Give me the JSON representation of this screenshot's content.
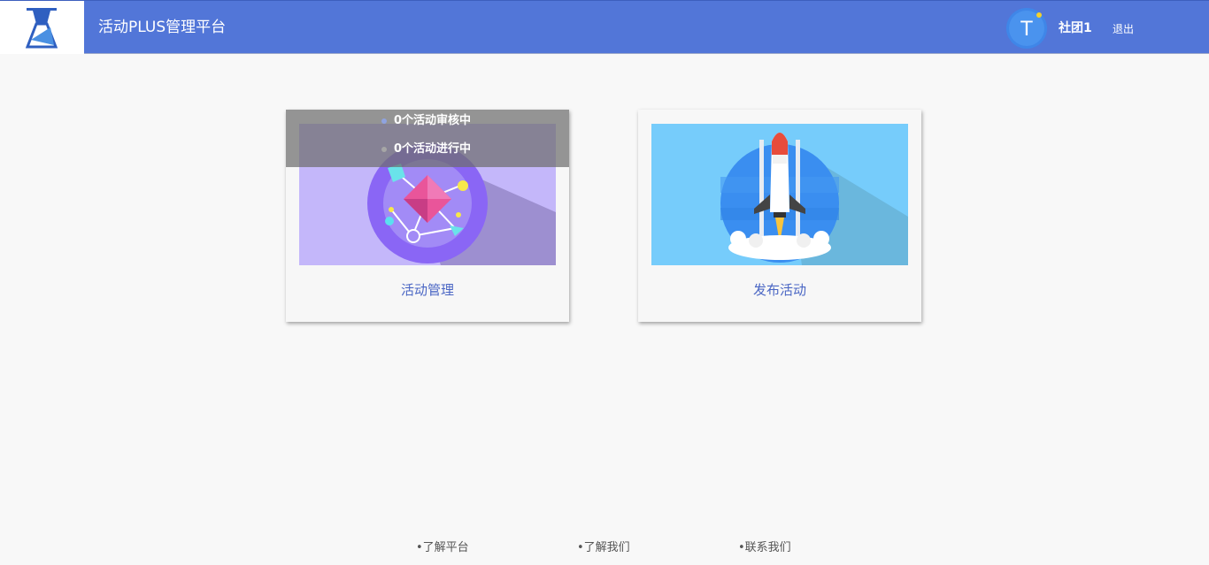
{
  "header": {
    "title": "活动PLUS管理平台",
    "user_name": "社团1",
    "logout_label": "退出",
    "avatar_letter": "T",
    "logo_icon": "flask-logo-icon"
  },
  "colors": {
    "header_bg": "#5276d8",
    "card_label": "#4a66c4",
    "page_bg": "#f8f8f8",
    "manage_illustration_bg": "#c4b7fa",
    "publish_illustration_bg": "#76ccfb"
  },
  "cards": [
    {
      "label": "活动管理",
      "icon": "gem-network-illustration",
      "stats": [
        {
          "text": "0个活动审核中"
        },
        {
          "text": "0个活动进行中"
        }
      ]
    },
    {
      "label": "发布活动",
      "icon": "rocket-launch-illustration"
    }
  ],
  "footer": {
    "links": [
      "•了解平台",
      "•了解我们",
      "•联系我们"
    ]
  }
}
